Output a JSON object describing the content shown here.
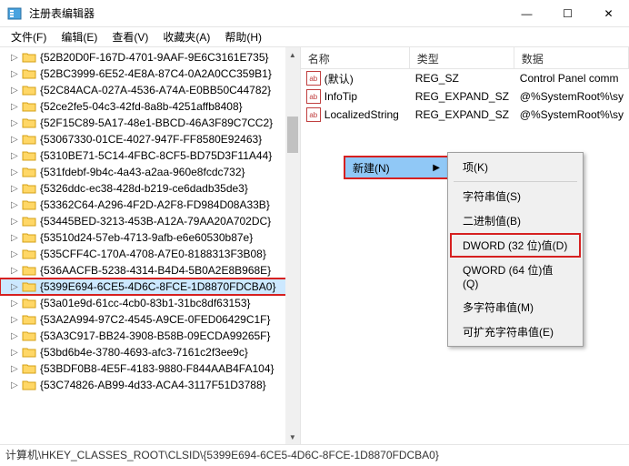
{
  "window": {
    "title": "注册表编辑器",
    "min": "—",
    "max": "☐",
    "close": "✕"
  },
  "menu": {
    "file": "文件(F)",
    "edit": "编辑(E)",
    "view": "查看(V)",
    "favorites": "收藏夹(A)",
    "help": "帮助(H)"
  },
  "tree": {
    "items": [
      "{52B20D0F-167D-4701-9AAF-9E6C3161E735}",
      "{52BC3999-6E52-4E8A-87C4-0A2A0CC359B1}",
      "{52C84ACA-027A-4536-A74A-E0BB50C44782}",
      "{52ce2fe5-04c3-42fd-8a8b-4251affb8408}",
      "{52F15C89-5A17-48e1-BBCD-46A3F89C7CC2}",
      "{53067330-01CE-4027-947F-FF8580E92463}",
      "{5310BE71-5C14-4FBC-8CF5-BD75D3F11A44}",
      "{531fdebf-9b4c-4a43-a2aa-960e8fcdc732}",
      "{5326ddc-ec38-428d-b219-ce6dadb35de3}",
      "{53362C64-A296-4F2D-A2F8-FD984D08A33B}",
      "{53445BED-3213-453B-A12A-79AA20A702DC}",
      "{53510d24-57eb-4713-9afb-e6e60530b87e}",
      "{535CFF4C-170A-4708-A7E0-8188313F3B08}",
      "{536AACFB-5238-4314-B4D4-5B0A2E8B968E}",
      "{5399E694-6CE5-4D6C-8FCE-1D8870FDCBA0}",
      "{53a01e9d-61cc-4cb0-83b1-31bc8df63153}",
      "{53A2A994-97C2-4545-A9CE-0FED06429C1F}",
      "{53A3C917-BB24-3908-B58B-09ECDA99265F}",
      "{53bd6b4e-3780-4693-afc3-7161c2f3ee9c}",
      "{53BDF0B8-4E5F-4183-9880-F844AAB4FA104}",
      "{53C74826-AB99-4d33-ACA4-3117F51D3788}"
    ],
    "selectedIndex": 14
  },
  "list": {
    "headers": {
      "name": "名称",
      "type": "类型",
      "data": "数据"
    },
    "rows": [
      {
        "icon": "ab",
        "name": "(默认)",
        "type": "REG_SZ",
        "data": "Control Panel comm"
      },
      {
        "icon": "ab",
        "name": "InfoTip",
        "type": "REG_EXPAND_SZ",
        "data": "@%SystemRoot%\\sy"
      },
      {
        "icon": "ab",
        "name": "LocalizedString",
        "type": "REG_EXPAND_SZ",
        "data": "@%SystemRoot%\\sy"
      }
    ]
  },
  "context": {
    "new": "新建(N)",
    "arrow": "▶",
    "items": {
      "key": "项(K)",
      "string": "字符串值(S)",
      "binary": "二进制值(B)",
      "dword": "DWORD (32 位)值(D)",
      "qword": "QWORD (64 位)值(Q)",
      "multi": "多字符串值(M)",
      "expand": "可扩充字符串值(E)"
    }
  },
  "status": {
    "path": "计算机\\HKEY_CLASSES_ROOT\\CLSID\\{5399E694-6CE5-4D6C-8FCE-1D8870FDCBA0}"
  }
}
